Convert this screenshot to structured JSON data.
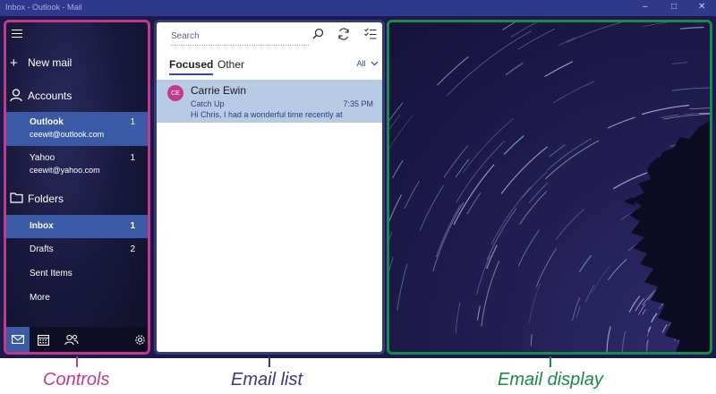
{
  "window": {
    "title": "Inbox - Outlook - Mail",
    "controls": [
      "–",
      "□",
      "✕"
    ]
  },
  "sidebar": {
    "new_mail_label": "New mail",
    "accounts_label": "Accounts",
    "accounts": [
      {
        "name": "Outlook",
        "email": "ceewit@outlook.com",
        "count": "1",
        "selected": true
      },
      {
        "name": "Yahoo",
        "email": "ceewit@yahoo.com",
        "count": "1",
        "selected": false
      }
    ],
    "folders_label": "Folders",
    "folders": [
      {
        "name": "Inbox",
        "count": "1",
        "selected": true
      },
      {
        "name": "Drafts",
        "count": "2",
        "selected": false
      },
      {
        "name": "Sent Items",
        "count": "",
        "selected": false
      },
      {
        "name": "More",
        "count": "",
        "selected": false
      }
    ],
    "bottom_icons": [
      "mail-icon",
      "calendar-icon",
      "people-icon",
      "settings-icon"
    ]
  },
  "email_list": {
    "search_placeholder": "Search",
    "tabs": {
      "focused": "Focused",
      "other": "Other"
    },
    "filter_label": "All",
    "emails": [
      {
        "initials": "CE",
        "sender": "Carrie Ewin",
        "subject": "Catch Up",
        "preview": "Hi Chris,   I had a wonderful time recently at",
        "time": "7:35 PM"
      }
    ]
  },
  "captions": {
    "controls": "Controls",
    "email_list": "Email list",
    "email_display": "Email display"
  },
  "colors": {
    "controls_accent": "#c03a8c",
    "email_list_accent": "#363b7a",
    "email_display_accent": "#1a8a4a",
    "selection": "#3a5aa6"
  }
}
